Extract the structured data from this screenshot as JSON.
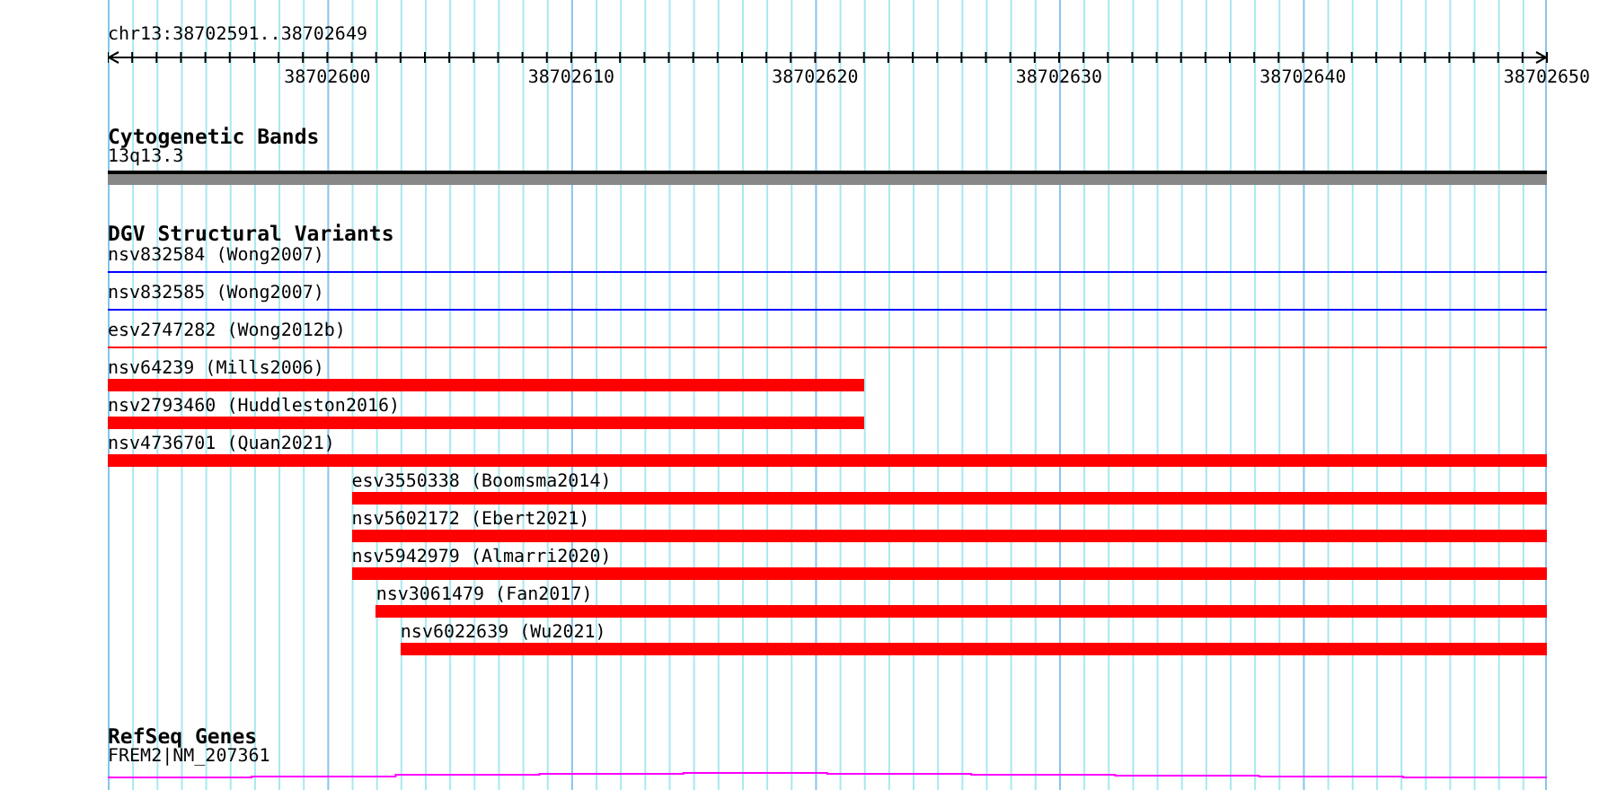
{
  "ruler": {
    "location": "chr13:38702591..38702649",
    "ticks": [
      "38702600",
      "38702610",
      "38702620",
      "38702630",
      "38702640",
      "38702650"
    ]
  },
  "cytogenetic_bands": {
    "title": "Cytogenetic Bands",
    "band": "13q13.3"
  },
  "dgv_structural_variants": {
    "title": "DGV Structural Variants",
    "features": [
      {
        "label": "nsv832584 (Wong2007)",
        "kind": "line",
        "color": "#0000ff"
      },
      {
        "label": "nsv832585 (Wong2007)",
        "kind": "line",
        "color": "#0000ff"
      },
      {
        "label": "esv2747282 (Wong2012b)",
        "kind": "line",
        "color": "#ff0000"
      },
      {
        "label": "nsv64239 (Mills2006)",
        "kind": "bar",
        "color": "#ff0000"
      },
      {
        "label": "nsv2793460 (Huddleston2016)",
        "kind": "bar",
        "color": "#ff0000"
      },
      {
        "label": "nsv4736701 (Quan2021)",
        "kind": "bar",
        "color": "#ff0000"
      },
      {
        "label": "esv3550338 (Boomsma2014)",
        "kind": "bar",
        "color": "#ff0000"
      },
      {
        "label": "nsv5602172 (Ebert2021)",
        "kind": "bar",
        "color": "#ff0000"
      },
      {
        "label": "nsv5942979 (Almarri2020)",
        "kind": "bar",
        "color": "#ff0000"
      },
      {
        "label": "nsv3061479 (Fan2017)",
        "kind": "bar",
        "color": "#ff0000"
      },
      {
        "label": "nsv6022639 (Wu2021)",
        "kind": "bar",
        "color": "#ff0000"
      }
    ]
  },
  "refseq_genes": {
    "title": "RefSeq Genes",
    "genes": [
      {
        "label": "FREM2|NM_207361"
      }
    ]
  }
}
